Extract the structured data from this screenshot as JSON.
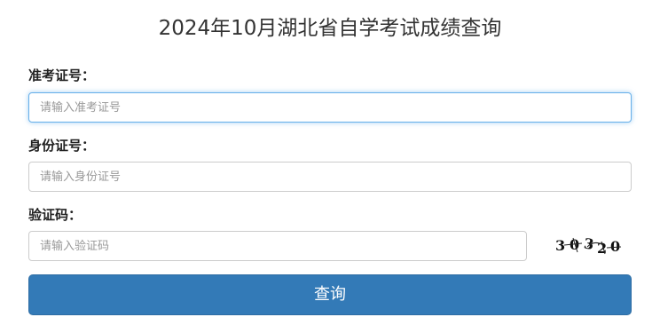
{
  "page": {
    "title": "2024年10月湖北省自学考试成绩查询"
  },
  "form": {
    "exam_number": {
      "label": "准考证号：",
      "value": "",
      "placeholder": "请输入准考证号"
    },
    "id_number": {
      "label": "身份证号：",
      "value": "",
      "placeholder": "请输入身份证号"
    },
    "captcha": {
      "label": "验证码：",
      "value": "",
      "placeholder": "请输入验证码",
      "image_text": "30320"
    },
    "submit_label": "查询"
  },
  "colors": {
    "primary_button": "#337ab7",
    "focus_border": "#66afe9",
    "input_border": "#cccccc"
  }
}
